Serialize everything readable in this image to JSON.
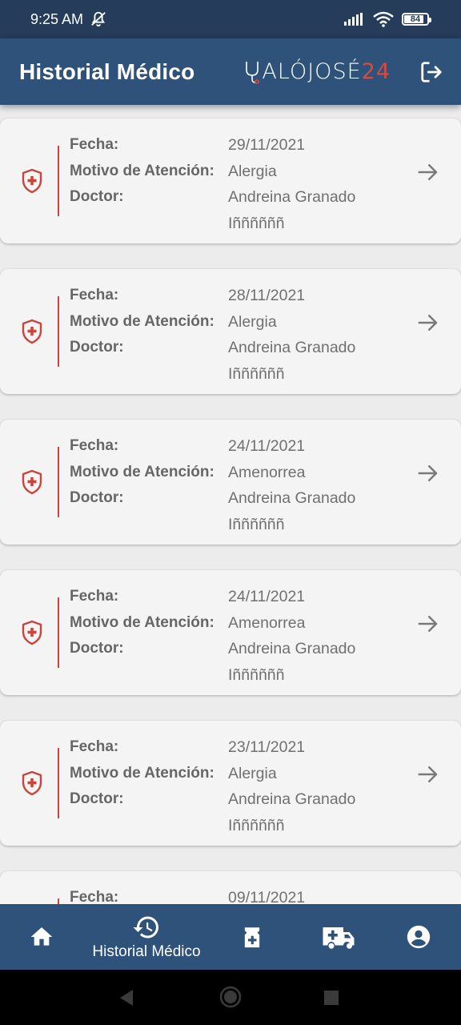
{
  "status_bar": {
    "time": "9:25 AM",
    "battery": "84",
    "battery_level_percent": 84
  },
  "app_bar": {
    "title": "Historial Médico",
    "brand_text": "ALÓJOSÉ",
    "brand_number": "24"
  },
  "labels": {
    "date": "Fecha:",
    "reason": "Motivo de Atención:",
    "doctor": "Doctor:"
  },
  "records": [
    {
      "date": "29/11/2021",
      "reason": "Alergia",
      "doctor_first": "Andreina Granado",
      "doctor_last": "Iññññññ"
    },
    {
      "date": "28/11/2021",
      "reason": "Alergia",
      "doctor_first": "Andreina Granado",
      "doctor_last": "Iññññññ"
    },
    {
      "date": "24/11/2021",
      "reason": "Amenorrea",
      "doctor_first": "Andreina Granado",
      "doctor_last": "Iññññññ"
    },
    {
      "date": "24/11/2021",
      "reason": "Amenorrea",
      "doctor_first": "Andreina Granado",
      "doctor_last": "Iññññññ"
    },
    {
      "date": "23/11/2021",
      "reason": "Alergia",
      "doctor_first": "Andreina Granado",
      "doctor_last": "Iññññññ"
    },
    {
      "date": "09/11/2021"
    }
  ],
  "bottom_nav": {
    "items": [
      {
        "icon": "home-icon",
        "label": ""
      },
      {
        "icon": "history-icon",
        "label": "Historial Médico",
        "active": true
      },
      {
        "icon": "pharmacy-icon",
        "label": ""
      },
      {
        "icon": "ambulance-icon",
        "label": ""
      },
      {
        "icon": "account-icon",
        "label": ""
      }
    ]
  },
  "colors": {
    "status_bar": "#253c5a",
    "app_bar": "#2e5279",
    "accent_red": "#c8463d",
    "background": "#ececec",
    "card": "#f4f4f4"
  }
}
